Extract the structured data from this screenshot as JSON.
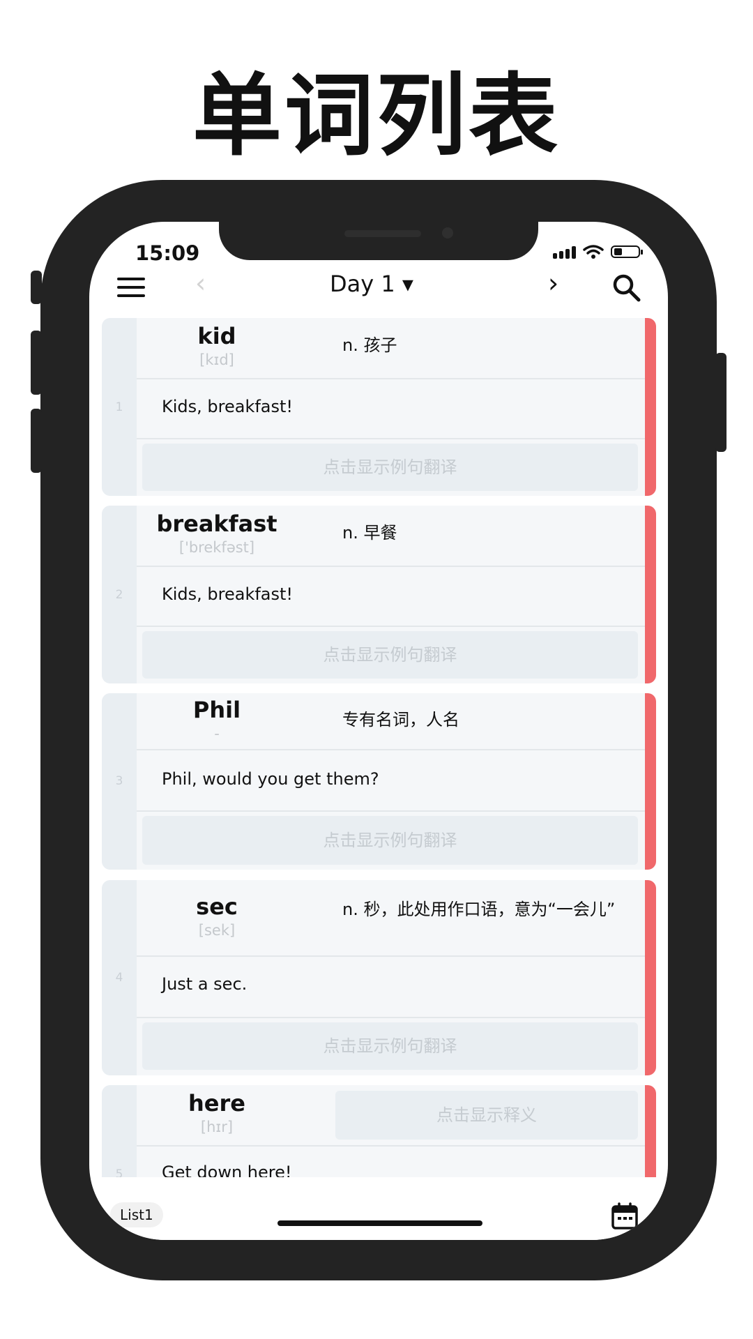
{
  "banner": {
    "title": "单词列表"
  },
  "status_bar": {
    "time": "15:09",
    "battery_level": 0.35
  },
  "navbar": {
    "prev": "‹",
    "title": "Day 1 ▾",
    "next": "›"
  },
  "words": [
    {
      "index": "1",
      "word": "kid",
      "phonetic": "[kɪd]",
      "meaning": "n. 孩子",
      "example": "Kids, breakfast!",
      "translation_button": "点击显示例句翻译"
    },
    {
      "index": "2",
      "word": "breakfast",
      "phonetic": "['brekfəst]",
      "meaning": "n. 早餐",
      "example": "Kids, breakfast!",
      "translation_button": "点击显示例句翻译"
    },
    {
      "index": "3",
      "word": "Phil",
      "phonetic": "-",
      "meaning": "专有名词，人名",
      "example": "Phil, would you get them?",
      "translation_button": "点击显示例句翻译"
    },
    {
      "index": "4",
      "word": "sec",
      "phonetic": "[sek]",
      "meaning": "n. 秒，此处用作口语，意为“一会儿”",
      "example": "Just a sec.",
      "translation_button": "点击显示例句翻译"
    },
    {
      "index": "5",
      "word": "here",
      "phonetic": "[hɪr]",
      "meaning_button": "点击显示释义",
      "example": "Get down here!"
    }
  ],
  "bottom_bar": {
    "list_label": "List1"
  },
  "colors": {
    "accent": "#f0686b",
    "card_bg": "#f5f7f9",
    "index_bg": "#e9eef2"
  }
}
